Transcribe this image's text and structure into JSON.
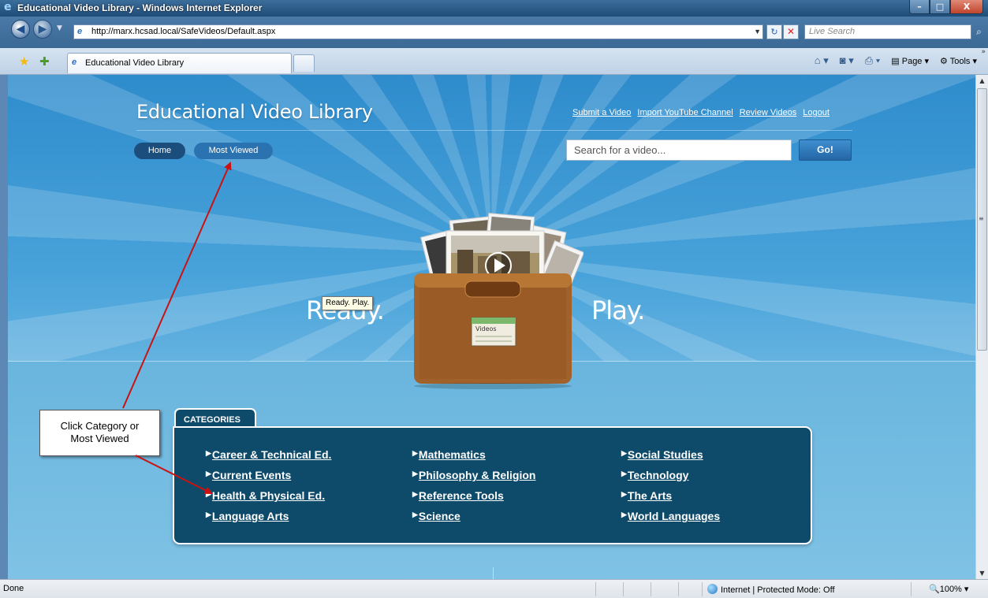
{
  "window": {
    "title": "Educational Video Library - Windows Internet Explorer",
    "min_glyph": "–",
    "max_glyph": "□",
    "close_glyph": "X"
  },
  "addressbar": {
    "url": "http://marx.hcsad.local/SafeVideos/Default.aspx",
    "search_placeholder": "Live Search"
  },
  "tab": {
    "title": "Educational Video Library"
  },
  "commandbar": {
    "page_label": "Page",
    "tools_label": "Tools"
  },
  "site": {
    "title": "Educational Video Library",
    "top_links": [
      "Submit a Video",
      "Import YouTube Channel",
      "Review Videos",
      "Logout"
    ],
    "nav": {
      "home": "Home",
      "most_viewed": "Most Viewed"
    },
    "search": {
      "placeholder": "Search for a video...",
      "go": "Go!"
    },
    "hero": {
      "left_word": "Ready.",
      "right_word": "Play.",
      "tooltip": "Ready. Play.",
      "box_label": "Videos"
    },
    "categories": {
      "tab_label": "CATEGORIES",
      "columns": [
        [
          "Career & Technical Ed.",
          "Current Events",
          "Health & Physical Ed.",
          "Language Arts"
        ],
        [
          "Mathematics",
          "Philosophy & Religion",
          "Reference Tools",
          "Science"
        ],
        [
          "Social Studies",
          "Technology",
          "The Arts",
          "World Languages"
        ]
      ]
    }
  },
  "callout": {
    "text_line1": "Click Category or",
    "text_line2": "Most Viewed"
  },
  "statusbar": {
    "status": "Done",
    "zone": "Internet | Protected Mode: Off",
    "zoom": "100%"
  },
  "colors": {
    "sky": "#2f8ccc",
    "panel": "#0e4b6b",
    "annotation_arrow": "#cc1111"
  }
}
